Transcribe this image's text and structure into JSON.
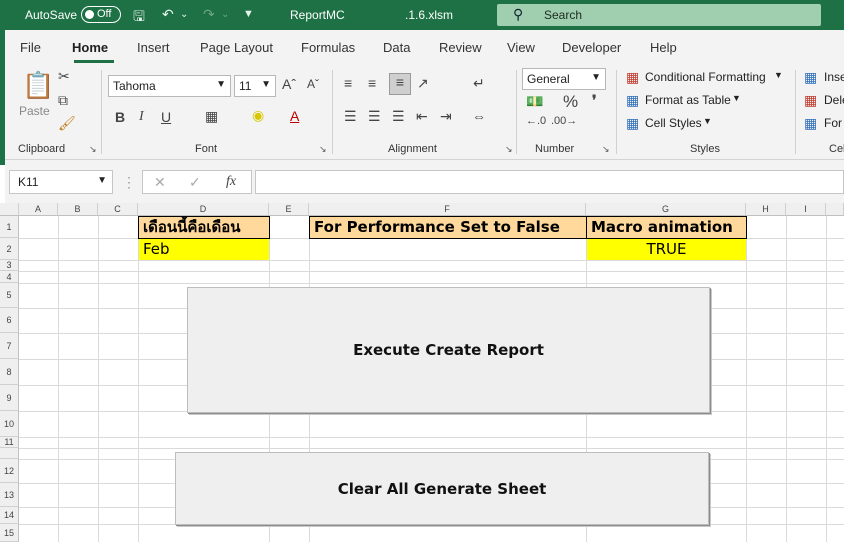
{
  "titlebar": {
    "autosave_label": "AutoSave",
    "autosave_state": "Off",
    "filename": "ReportMC",
    "extension": ".1.6.xlsm",
    "search_placeholder": "Search"
  },
  "menu": {
    "tabs": [
      "File",
      "Home",
      "Insert",
      "Page Layout",
      "Formulas",
      "Data",
      "Review",
      "View",
      "Developer",
      "Help"
    ],
    "active_tab": "Home"
  },
  "ribbon": {
    "clipboard": {
      "label": "Clipboard",
      "paste": "Paste"
    },
    "font": {
      "label": "Font",
      "name": "Tahoma",
      "size": "11",
      "bold": "B",
      "italic": "I",
      "underline": "U"
    },
    "alignment": {
      "label": "Alignment"
    },
    "number": {
      "label": "Number",
      "format": "General",
      "percent": "%"
    },
    "styles": {
      "label": "Styles",
      "conditional_formatting": "Conditional Formatting",
      "format_as_table": "Format as Table",
      "cell_styles": "Cell Styles"
    },
    "cells": {
      "label": "Cel",
      "insert": "Inse",
      "delete": "Dele",
      "format": "For"
    }
  },
  "formula_bar": {
    "name_box": "K11",
    "fx": "fx",
    "value": ""
  },
  "grid": {
    "columns": [
      "A",
      "B",
      "C",
      "D",
      "E",
      "F",
      "G",
      "H",
      "I"
    ],
    "rows": [
      "1",
      "2",
      "3",
      "4",
      "5",
      "6",
      "7",
      "8",
      "9",
      "10",
      "11",
      "12",
      "13",
      "14",
      "15"
    ],
    "cells": {
      "D1": "เดือนนี้คือเดือน",
      "F1": "For Performance Set to False",
      "G1": "Macro animation",
      "D2": "Feb",
      "G2": "TRUE"
    }
  },
  "buttons": {
    "execute": "Execute Create Report",
    "clear": "Clear All Generate Sheet"
  },
  "colors": {
    "excel_green": "#1e7145",
    "header_fill": "#ffd89b",
    "value_fill": "#ffff00"
  }
}
